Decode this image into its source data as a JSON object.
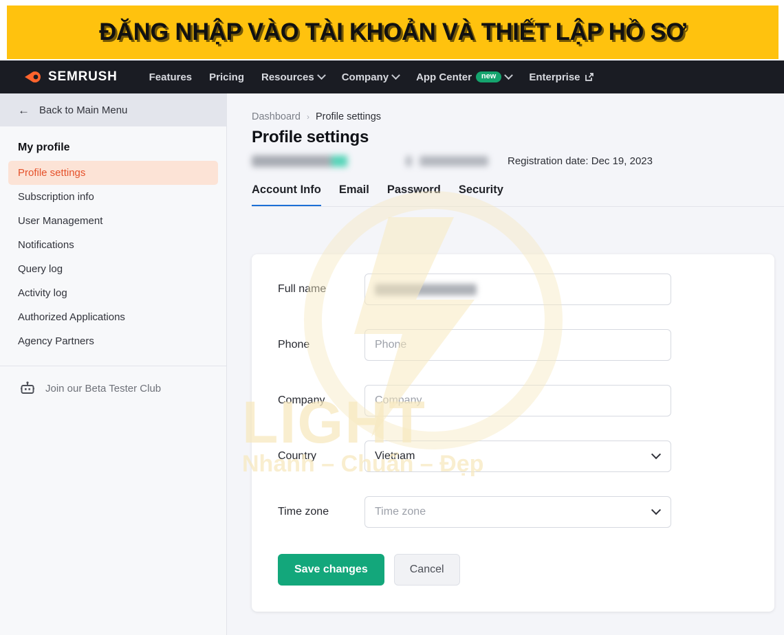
{
  "banner": {
    "text": "ĐĂNG NHẬP VÀO TÀI KHOẢN VÀ THIẾT LẬP HỒ SƠ",
    "background": "#FFC20E",
    "text_color": "#111111"
  },
  "topnav": {
    "brand": "SEMRUSH",
    "brand_color": "#FF642D",
    "background": "#1A1C23",
    "links": [
      {
        "label": "Features",
        "caret": false,
        "badge": null,
        "external": false
      },
      {
        "label": "Pricing",
        "caret": false,
        "badge": null,
        "external": false
      },
      {
        "label": "Resources",
        "caret": true,
        "badge": null,
        "external": false
      },
      {
        "label": "Company",
        "caret": true,
        "badge": null,
        "external": false
      },
      {
        "label": "App Center",
        "caret": true,
        "badge": "new",
        "external": false
      },
      {
        "label": "Enterprise",
        "caret": false,
        "badge": null,
        "external": true
      }
    ],
    "badge_color": "#15A46E"
  },
  "sidebar": {
    "back_label": "Back to Main Menu",
    "section_title": "My profile",
    "items": [
      {
        "label": "Profile settings",
        "active": true
      },
      {
        "label": "Subscription info",
        "active": false
      },
      {
        "label": "User Management",
        "active": false
      },
      {
        "label": "Notifications",
        "active": false
      },
      {
        "label": "Query log",
        "active": false
      },
      {
        "label": "Activity log",
        "active": false
      },
      {
        "label": "Authorized Applications",
        "active": false
      },
      {
        "label": "Agency Partners",
        "active": false
      }
    ],
    "beta_label": "Join our Beta Tester Club",
    "active_bg": "#FCE3D6",
    "active_color": "#E5512A"
  },
  "main": {
    "breadcrumb": {
      "parent": "Dashboard",
      "separator": "›",
      "current": "Profile settings"
    },
    "page_title": "Profile settings",
    "registration": "Registration date: Dec 19, 2023",
    "tabs": [
      {
        "label": "Account Info",
        "active": true
      },
      {
        "label": "Email",
        "active": false
      },
      {
        "label": "Password",
        "active": false
      },
      {
        "label": "Security",
        "active": false
      }
    ],
    "tab_accent": "#1C6FD6"
  },
  "form": {
    "fields": [
      {
        "label": "Full name",
        "value": "",
        "placeholder": "",
        "type": "text",
        "redacted": true
      },
      {
        "label": "Phone",
        "value": "",
        "placeholder": "Phone",
        "type": "text",
        "redacted": false
      },
      {
        "label": "Company",
        "value": "",
        "placeholder": "Company",
        "type": "text",
        "redacted": false
      },
      {
        "label": "Country",
        "value": "Vietnam",
        "placeholder": "",
        "type": "select",
        "redacted": false
      },
      {
        "label": "Time zone",
        "value": "",
        "placeholder": "Time zone",
        "type": "select",
        "redacted": false
      }
    ],
    "save_label": "Save changes",
    "cancel_label": "Cancel",
    "save_color": "#13A77B"
  },
  "watermark": {
    "title": "LIGHT",
    "subtitle": "Nhanh – Chuẩn – Đẹp",
    "color": "#F7E9C0"
  }
}
